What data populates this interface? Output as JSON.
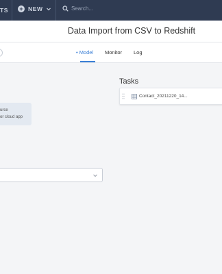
{
  "topbar": {
    "partial_label": "TS",
    "new_label": "NEW",
    "search_placeholder": "Search..."
  },
  "page": {
    "title": "Data Import from CSV to Redshift"
  },
  "tabs": [
    {
      "label": "Model",
      "active": true
    },
    {
      "label": "Monitor",
      "active": false
    },
    {
      "label": "Log",
      "active": false
    }
  ],
  "source_card": {
    "line1": "urce",
    "line2": "or cloud app"
  },
  "tasks": {
    "heading": "Tasks",
    "items": [
      {
        "name": "Contact_20211220_14..."
      }
    ]
  },
  "colors": {
    "topbar_bg": "#2f3b52",
    "accent": "#3a7fd6",
    "card_bg": "#e3e9f1"
  }
}
